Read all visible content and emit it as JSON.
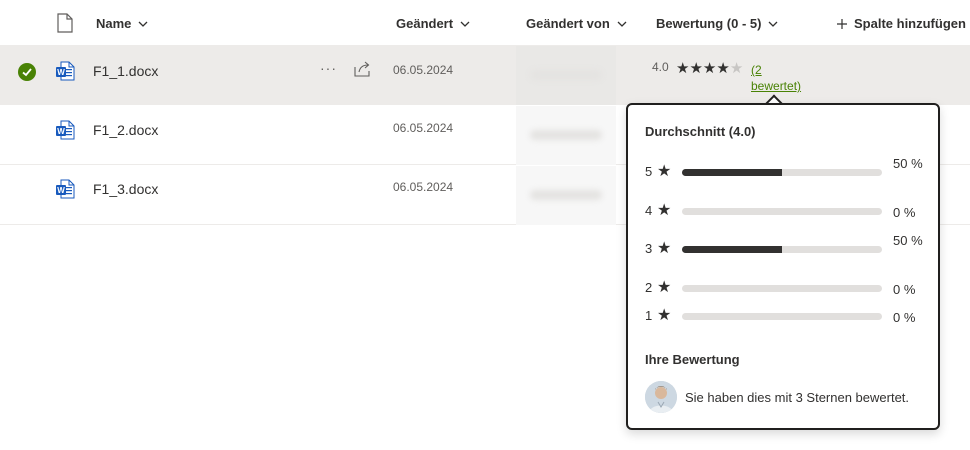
{
  "columns": {
    "name": "Name",
    "modified": "Geändert",
    "modified_by": "Geändert von",
    "rating": "Bewertung (0 - 5)",
    "add_column": "Spalte hinzufügen"
  },
  "files": [
    {
      "name": "F1_1.docx",
      "date": "06.05.2024",
      "selected": true,
      "icon": "word-document-icon"
    },
    {
      "name": "F1_2.docx",
      "date": "06.05.2024",
      "selected": false,
      "icon": "word-document-icon"
    },
    {
      "name": "F1_3.docx",
      "date": "06.05.2024",
      "selected": false,
      "icon": "word-document-icon"
    }
  ],
  "row_actions": {
    "more": "···"
  },
  "rating": {
    "value": "4.0",
    "stars_filled": 4,
    "stars_total": 5,
    "rated_count_text": "(2 bewertet)"
  },
  "popup": {
    "average_title": "Durchschnitt (4.0)",
    "distribution": [
      {
        "stars": "5",
        "percent": 50,
        "label": "50 %"
      },
      {
        "stars": "4",
        "percent": 0,
        "label": "0 %"
      },
      {
        "stars": "3",
        "percent": 50,
        "label": "50 %"
      },
      {
        "stars": "2",
        "percent": 0,
        "label": "0 %"
      },
      {
        "stars": "1",
        "percent": 0,
        "label": "0 %"
      }
    ],
    "your_rating_title": "Ihre Bewertung",
    "your_rating_text": "Sie haben dies mit 3 Sternen bewertet."
  },
  "colors": {
    "accent_green": "#498205",
    "selected_row": "#edebe9",
    "word_blue": "#185abd"
  }
}
